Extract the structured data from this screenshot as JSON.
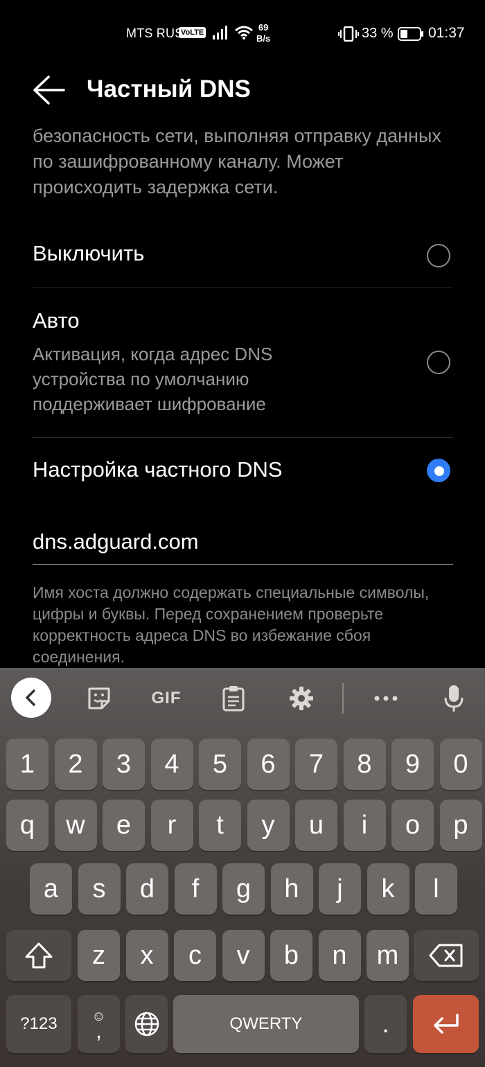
{
  "status_bar": {
    "carrier": "MTS RUS",
    "volte": "VoLTE",
    "speed_value": "69",
    "speed_unit": "B/s",
    "battery_percent": "33 %",
    "time": "01:37"
  },
  "header": {
    "title": "Частный DNS"
  },
  "description": "безопасность сети, выполняя отправку данных по зашифрованному каналу. Может происходить задержка сети.",
  "options": [
    {
      "title": "Выключить",
      "subtitle": "",
      "selected": false
    },
    {
      "title": "Авто",
      "subtitle": "Активация, когда адрес DNS устройства по умолчанию поддерживает шифрование",
      "selected": false
    },
    {
      "title": "Настройка частного DNS",
      "subtitle": "",
      "selected": true
    }
  ],
  "dns_field": {
    "value": "dns.adguard.com"
  },
  "hint": "Имя хоста должно содержать специальные символы, цифры и буквы. Перед сохранением проверьте корректность адреса DNS во избежание сбоя соединения.",
  "keyboard": {
    "toolbar": {
      "gif_label": "GIF"
    },
    "row_numbers": [
      "1",
      "2",
      "3",
      "4",
      "5",
      "6",
      "7",
      "8",
      "9",
      "0"
    ],
    "row_top": [
      "q",
      "w",
      "e",
      "r",
      "t",
      "y",
      "u",
      "i",
      "o",
      "p"
    ],
    "row_middle": [
      "a",
      "s",
      "d",
      "f",
      "g",
      "h",
      "j",
      "k",
      "l"
    ],
    "row_bottom": [
      "z",
      "x",
      "c",
      "v",
      "b",
      "n",
      "m"
    ],
    "symbols_label": "?123",
    "comma_label": ",",
    "space_label": "QWERTY",
    "period_label": ".",
    "accent_color": "#2f7cf6",
    "enter_color": "#c2553a"
  }
}
